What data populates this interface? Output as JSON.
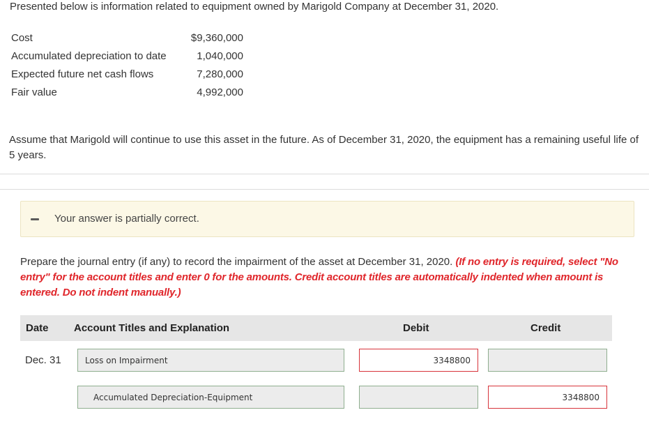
{
  "intro": "Presented below is information related to equipment owned by Marigold Company at December 31, 2020.",
  "info_rows": [
    {
      "label": "Cost",
      "value": "$9,360,000"
    },
    {
      "label": "Accumulated depreciation to date",
      "value": "1,040,000"
    },
    {
      "label": "Expected future net cash flows",
      "value": "7,280,000"
    },
    {
      "label": "Fair value",
      "value": "4,992,000"
    }
  ],
  "assumption": "Assume that Marigold will continue to use this asset in the future. As of December 31, 2020, the equipment has a remaining useful life of 5 years.",
  "feedback": {
    "text": "Your answer is partially correct."
  },
  "prompt": {
    "text": "Prepare the journal entry (if any) to record the impairment of the asset at December 31, 2020.",
    "instruction": "(If no entry is required, select \"No entry\" for the account titles and enter 0 for the amounts. Credit account titles are automatically indented when amount is entered. Do not indent manually.)"
  },
  "table": {
    "headers": {
      "date": "Date",
      "account": "Account Titles and Explanation",
      "debit": "Debit",
      "credit": "Credit"
    },
    "rows": [
      {
        "date": "Dec. 31",
        "account": "Loss on Impairment",
        "debit": "3348800",
        "credit": ""
      },
      {
        "date": "",
        "account": "Accumulated Depreciation-Equipment",
        "debit": "",
        "credit": "3348800"
      }
    ]
  },
  "colors": {
    "error_border": "#d7333a",
    "ok_border": "#8fae8f",
    "instruction_text": "#e0262b",
    "banner_bg": "#fcf8e6"
  }
}
